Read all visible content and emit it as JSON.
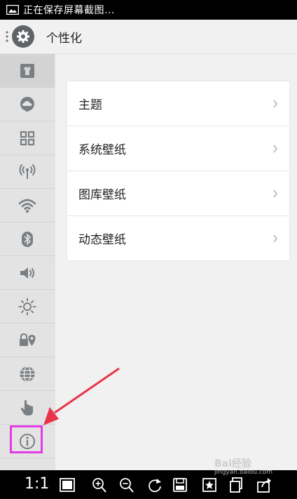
{
  "status_bar": {
    "text": "正在保存屏幕截图..."
  },
  "header": {
    "title": "个性化"
  },
  "sidebar": {
    "items": [
      {
        "name": "personalize",
        "icon": "shirt-icon",
        "active": true
      },
      {
        "name": "cloud",
        "icon": "cloud-icon"
      },
      {
        "name": "apps",
        "icon": "grid-icon"
      },
      {
        "name": "hotspot",
        "icon": "antenna-icon"
      },
      {
        "name": "wifi",
        "icon": "wifi-icon"
      },
      {
        "name": "bluetooth",
        "icon": "bluetooth-icon"
      },
      {
        "name": "sound",
        "icon": "speaker-icon"
      },
      {
        "name": "brightness",
        "icon": "sun-icon"
      },
      {
        "name": "security-location",
        "icon": "lock-location-icon"
      },
      {
        "name": "language",
        "icon": "globe-icon"
      },
      {
        "name": "gesture",
        "icon": "hand-icon"
      },
      {
        "name": "about",
        "icon": "info-icon"
      }
    ]
  },
  "content": {
    "rows": [
      {
        "label": "主题"
      },
      {
        "label": "系统壁纸"
      },
      {
        "label": "图库壁纸"
      },
      {
        "label": "动态壁纸"
      }
    ]
  },
  "toolbar": {
    "zoom_label": "1:1"
  },
  "watermark": {
    "brand": "Bai经验",
    "url": "jingyan.baidu.com"
  },
  "colors": {
    "highlight": "#e23be6",
    "arrow": "#e8344a",
    "icon_gray": "#7a7f83"
  }
}
